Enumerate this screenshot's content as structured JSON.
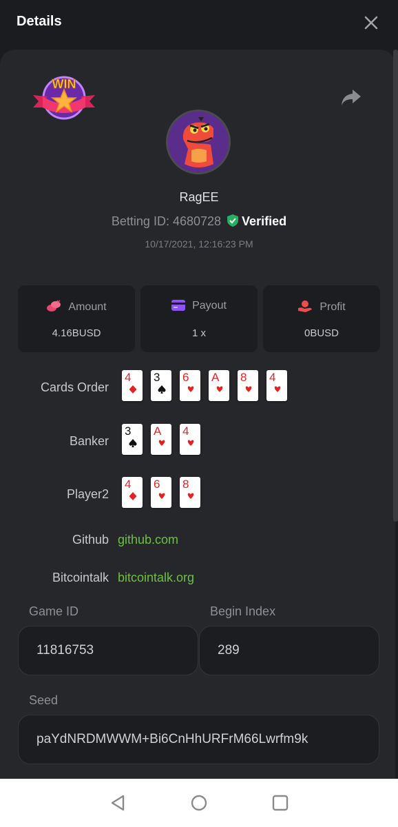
{
  "header": {
    "title": "Details"
  },
  "profile": {
    "badge_text": "WIN",
    "username": "RagEE",
    "betting_id_label": "Betting ID:",
    "betting_id": "4680728",
    "verified_label": "Verified",
    "datetime": "10/17/2021, 12:16:23 PM"
  },
  "stats": {
    "amount_label": "Amount",
    "amount_value": "4.16BUSD",
    "payout_label": "Payout",
    "payout_value": "1 x",
    "profit_label": "Profit",
    "profit_value": "0BUSD"
  },
  "cards_order": {
    "label": "Cards Order",
    "cards": [
      {
        "rank": "4",
        "suit": "diamond"
      },
      {
        "rank": "3",
        "suit": "spade"
      },
      {
        "rank": "6",
        "suit": "heart"
      },
      {
        "rank": "A",
        "suit": "heart"
      },
      {
        "rank": "8",
        "suit": "heart"
      },
      {
        "rank": "4",
        "suit": "heart"
      }
    ]
  },
  "banker": {
    "label": "Banker",
    "cards": [
      {
        "rank": "3",
        "suit": "spade"
      },
      {
        "rank": "A",
        "suit": "heart"
      },
      {
        "rank": "4",
        "suit": "heart"
      }
    ]
  },
  "player2": {
    "label": "Player2",
    "cards": [
      {
        "rank": "4",
        "suit": "diamond"
      },
      {
        "rank": "6",
        "suit": "heart"
      },
      {
        "rank": "8",
        "suit": "heart"
      }
    ]
  },
  "links": {
    "github_label": "Github",
    "github_url_text": "github.com",
    "bitcointalk_label": "Bitcointalk",
    "bitcointalk_url_text": "bitcointalk.org"
  },
  "fields": {
    "game_id_label": "Game ID",
    "game_id_value": "11816753",
    "begin_index_label": "Begin Index",
    "begin_index_value": "289",
    "seed_label": "Seed",
    "seed_value": "paYdNRDMWWM+Bi6CnHhURFrM66Lwrfm9k"
  },
  "colors": {
    "background": "#1b1c1f",
    "panel": "#26272b",
    "link": "#6cc13d",
    "verified": "#27ae60",
    "card_red": "#e32323",
    "amount_icon": "#e8456f",
    "payout_icon": "#8b55f5",
    "profit_icon": "#ee4d4d"
  },
  "icons": {
    "close": "close-icon",
    "share": "share-icon",
    "verified": "shield-check-icon",
    "amount": "coins-icon",
    "payout": "wallet-icon",
    "profit": "hand-coin-icon",
    "nav_back": "triangle-back-icon",
    "nav_home": "circle-home-icon",
    "nav_recent": "square-recent-icon"
  }
}
